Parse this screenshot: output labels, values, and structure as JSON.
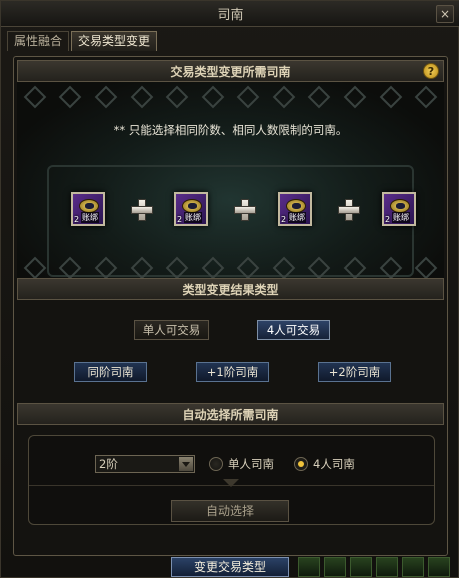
{
  "window": {
    "title": "司南",
    "close_label": "×"
  },
  "tabs": [
    {
      "label": "属性融合",
      "active": false
    },
    {
      "label": "交易类型变更",
      "active": true
    }
  ],
  "section1": {
    "header": "交易类型变更所需司南",
    "help_label": "?",
    "notice": "** 只能选择相同阶数、相同人数限制的司南。",
    "slots": [
      {
        "qty": "2",
        "bind": "账绑",
        "icon": "compass-icon"
      },
      {
        "qty": "2",
        "bind": "账绑",
        "icon": "compass-icon"
      },
      {
        "qty": "2",
        "bind": "账绑",
        "icon": "compass-icon"
      },
      {
        "qty": "2",
        "bind": "账绑",
        "icon": "compass-icon"
      }
    ]
  },
  "section2": {
    "header": "类型变更结果类型",
    "option_single": "单人可交易",
    "option_four": "4人可交易",
    "tier_same": "同阶司南",
    "tier_plus1": "+1阶司南",
    "tier_plus2": "+2阶司南"
  },
  "section3": {
    "header": "自动选择所需司南",
    "dropdown_value": "2阶",
    "radio_single": "单人司南",
    "radio_four": "4人司南",
    "radio_selected": "4人司南",
    "auto_button": "自动选择"
  },
  "footer": {
    "change_button": "变更交易类型"
  },
  "colors": {
    "accent_blue": "#213452",
    "radio_checked": "#f0c33c",
    "help_gold": "#f3d05a"
  }
}
